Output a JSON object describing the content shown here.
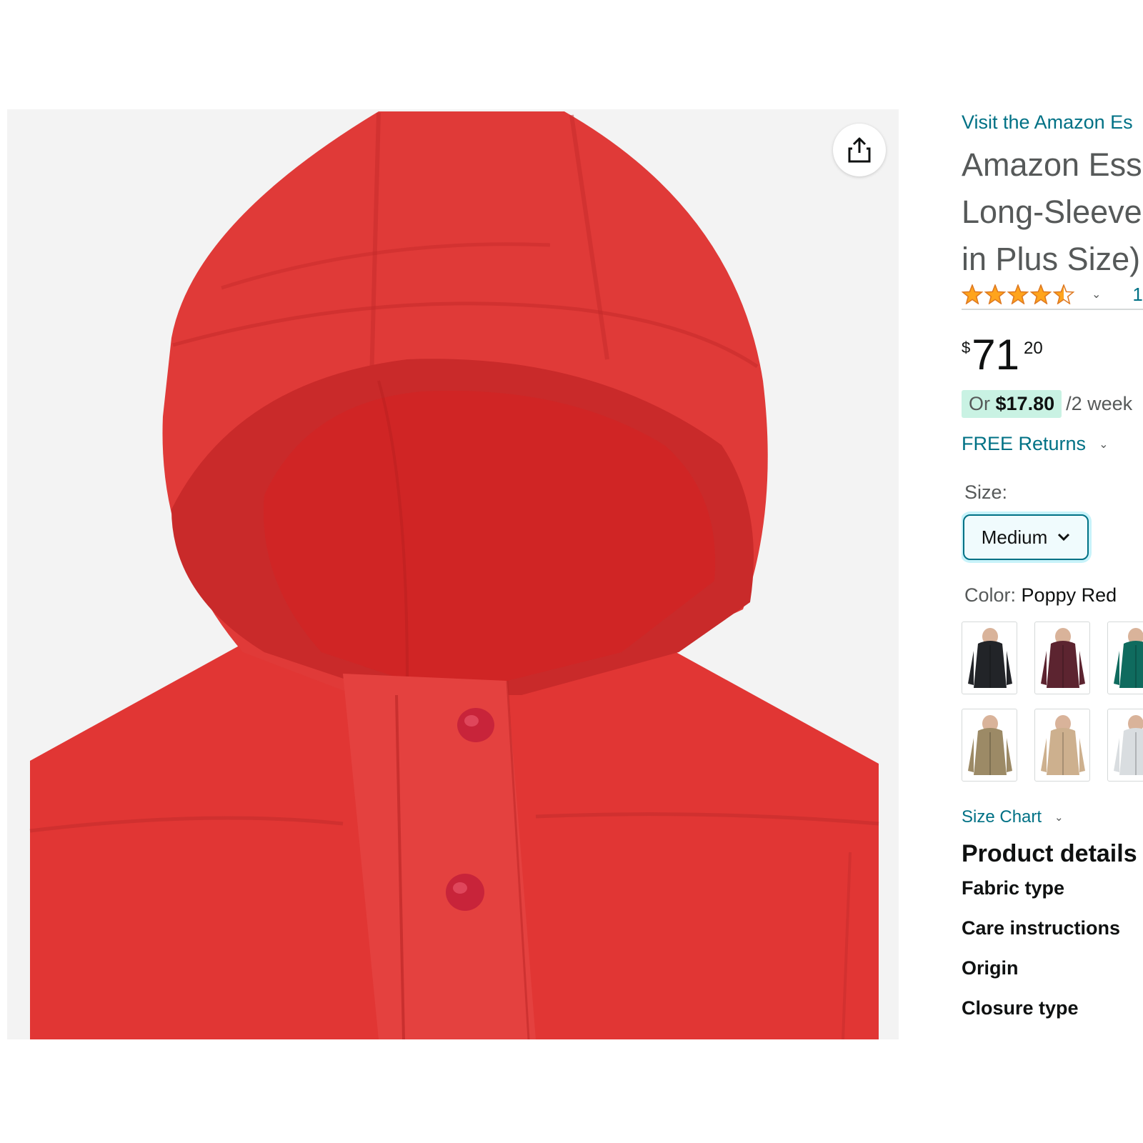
{
  "product_image": {
    "alt": "Amazon Essentials puffer jacket hood in Poppy Red"
  },
  "share_button": {
    "icon": "share-icon"
  },
  "store_link": "Visit the Amazon Es",
  "title_lines": [
    "Amazon Ess",
    "Long-Sleeve",
    "in Plus Size)"
  ],
  "rating": {
    "stars": 4.5,
    "star_color": "#ffa41c",
    "count_text": "1"
  },
  "price": {
    "symbol": "$",
    "whole": "71",
    "fraction": "20"
  },
  "installment": {
    "or_label": "Or",
    "amount": "$17.80",
    "period": "/2 week"
  },
  "returns": {
    "label": "FREE Returns"
  },
  "size": {
    "label": "Size:",
    "selected": "Medium"
  },
  "color": {
    "label": "Color:",
    "selected": "Poppy Red",
    "swatches": [
      {
        "name": "Black",
        "hex": "#222428"
      },
      {
        "name": "Burgundy",
        "hex": "#5c2430"
      },
      {
        "name": "Teal",
        "hex": "#0f6b5e"
      },
      {
        "name": "Olive Khaki",
        "hex": "#9c8a66"
      },
      {
        "name": "Light Tan",
        "hex": "#cdb08e"
      },
      {
        "name": "Floral White",
        "hex": "#d9dde0"
      }
    ]
  },
  "size_chart": {
    "label": "Size Chart"
  },
  "product_details": {
    "heading": "Product details",
    "rows": [
      "Fabric type",
      "Care instructions",
      "Origin",
      "Closure type"
    ]
  },
  "colors": {
    "link": "#007185",
    "accent_teal": "#007185",
    "jacket_red": "#e53a3a"
  }
}
